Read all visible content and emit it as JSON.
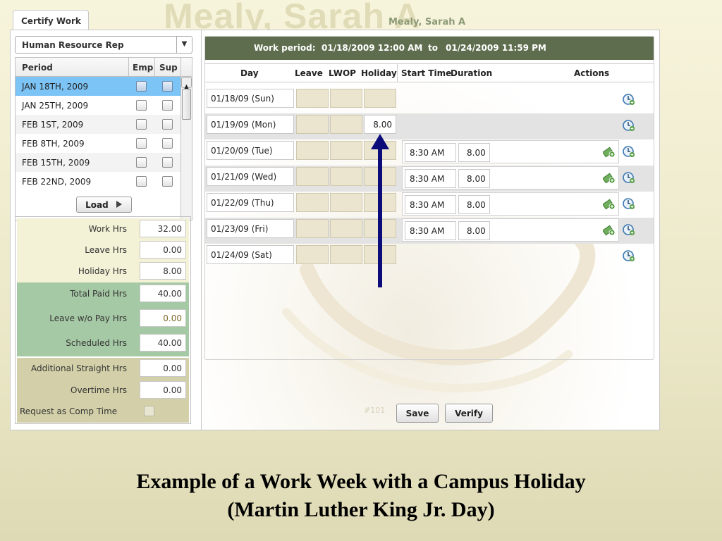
{
  "header": {
    "watermark_name": "Mealy, Sarah A",
    "employee_name": "Mealy, Sarah A",
    "tab_label": "Certify Work"
  },
  "role_select": {
    "selected": "Human Resource Rep",
    "arrow": "▼"
  },
  "period_table": {
    "headers": {
      "period": "Period",
      "emp": "Emp",
      "sup": "Sup"
    },
    "rows": [
      {
        "label": "JAN 18TH, 2009"
      },
      {
        "label": "JAN 25TH, 2009"
      },
      {
        "label": "FEB 1ST, 2009"
      },
      {
        "label": "FEB 8TH, 2009"
      },
      {
        "label": "FEB 15TH, 2009"
      },
      {
        "label": "FEB 22ND, 2009"
      }
    ]
  },
  "load_button": {
    "label": "Load"
  },
  "totals": {
    "work_hrs": {
      "label": "Work Hrs",
      "value": "32.00"
    },
    "leave_hrs": {
      "label": "Leave Hrs",
      "value": "0.00"
    },
    "holiday_hrs": {
      "label": "Holiday Hrs",
      "value": "8.00"
    },
    "total_paid_hrs": {
      "label": "Total Paid Hrs",
      "value": "40.00"
    },
    "leave_wo_pay_hrs": {
      "label": "Leave w/o Pay Hrs",
      "value": "0.00"
    },
    "scheduled_hrs": {
      "label": "Scheduled Hrs",
      "value": "40.00"
    },
    "additional_straight_hrs": {
      "label": "Additional Straight Hrs",
      "value": "0.00"
    },
    "overtime_hrs": {
      "label": "Overtime Hrs",
      "value": "0.00"
    },
    "request_comp_time": {
      "label": "Request as Comp Time"
    }
  },
  "work_period": {
    "label": "Work period:",
    "start": "01/18/2009 12:00 AM",
    "to": "to",
    "end": "01/24/2009 11:59 PM"
  },
  "columns": {
    "day": "Day",
    "leave": "Leave",
    "lwop": "LWOP",
    "holiday": "Holiday",
    "start_time": "Start Time",
    "duration": "Duration",
    "actions": "Actions"
  },
  "days": [
    {
      "day": "01/18/09 (Sun)"
    },
    {
      "day": "01/19/09 (Mon)",
      "holiday": "8.00"
    },
    {
      "day": "01/20/09 (Tue)",
      "start_time": "8:30 AM",
      "duration": "8.00"
    },
    {
      "day": "01/21/09 (Wed)",
      "start_time": "8:30 AM",
      "duration": "8.00"
    },
    {
      "day": "01/22/09 (Thu)",
      "start_time": "8:30 AM",
      "duration": "8.00"
    },
    {
      "day": "01/23/09 (Fri)",
      "start_time": "8:30 AM",
      "duration": "8.00"
    },
    {
      "day": "01/24/09 (Sat)"
    }
  ],
  "footer": {
    "faded_number": "#101",
    "save_label": "Save",
    "verify_label": "Verify"
  },
  "caption": {
    "line1": "Example of a Work Week with a Campus Holiday",
    "line2": "(Martin Luther King Jr. Day)"
  },
  "colors": {
    "work_period_bar": "#5e6d4d",
    "selected_row": "#7cc4f6",
    "totals_green": "#a6c9a5",
    "annotation_arrow": "#0b0b7a"
  },
  "icons": {
    "action_clock": "clock-add-icon",
    "action_money": "money-icon",
    "load_arrow": "triangle-right-icon"
  }
}
